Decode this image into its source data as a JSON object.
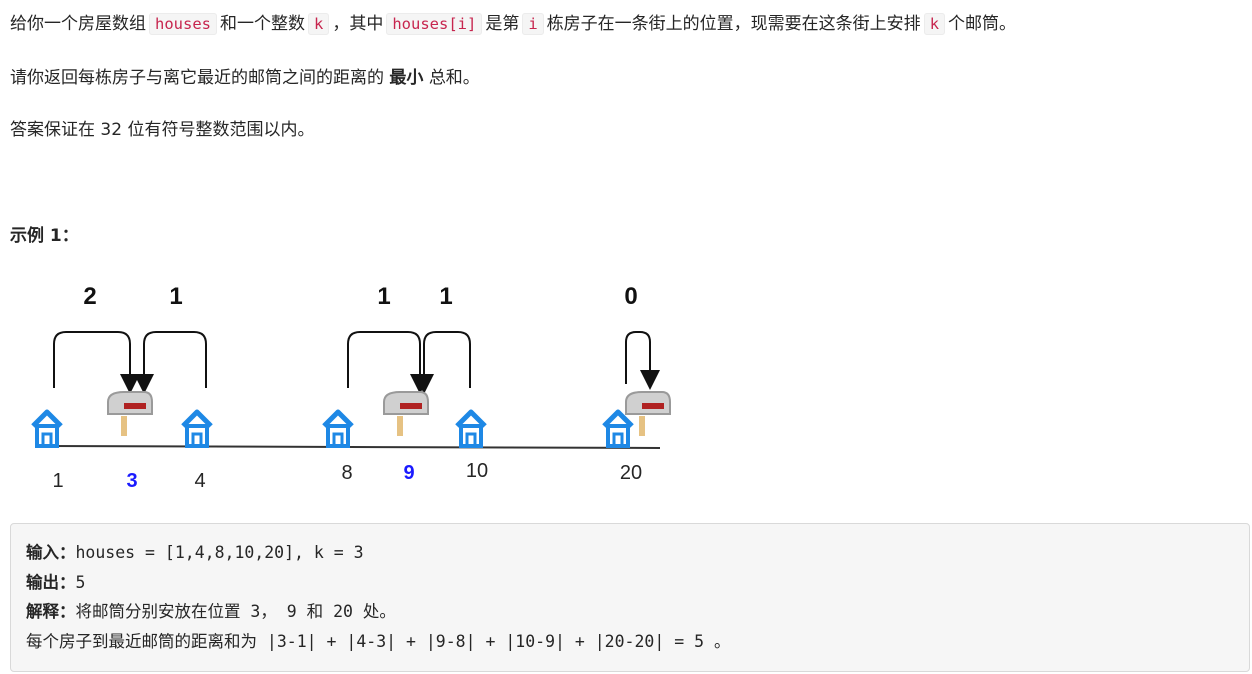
{
  "problem": {
    "p1": {
      "t1": "给你一个房屋数组",
      "c1": "houses",
      "t2": "和一个整数",
      "c2": "k",
      "t3": "，其中",
      "c3": "houses[i]",
      "t4": "是第",
      "c4": "i",
      "t5": "栋房子在一条街上的位置，现需要在这条街上安排",
      "c5": "k",
      "t6": "个邮筒。"
    },
    "p2": {
      "t1": "请你返回每栋房子与离它最近的邮筒之间的距离的",
      "bold": "最小",
      "t2": "总和。"
    },
    "p3": "答案保证在 32 位有符号整数范围以内。"
  },
  "example": {
    "title": "示例 1：",
    "input_label": "输入：",
    "input_text": "houses = [1,4,8,10,20], k = 3",
    "output_label": "输出：",
    "output_text": "5",
    "explain_label": "解释：",
    "explain_text": "将邮筒分别安放在位置 3， 9 和 20 处。",
    "explain_line2": "每个房子到最近邮筒的距离和为 |3-1| + |4-3| + |9-8| + |10-9| + |20-20| = 5 。"
  },
  "figure": {
    "colors": {
      "house": "#1e88e5",
      "mailbox_pos": "#1a1aff",
      "road": "#333333",
      "distance": "#111111"
    },
    "houses": [
      "1",
      "4",
      "8",
      "10",
      "20"
    ],
    "mailboxes": [
      "3",
      "9",
      "20"
    ],
    "distances": [
      "2",
      "1",
      "1",
      "1",
      "0"
    ]
  }
}
